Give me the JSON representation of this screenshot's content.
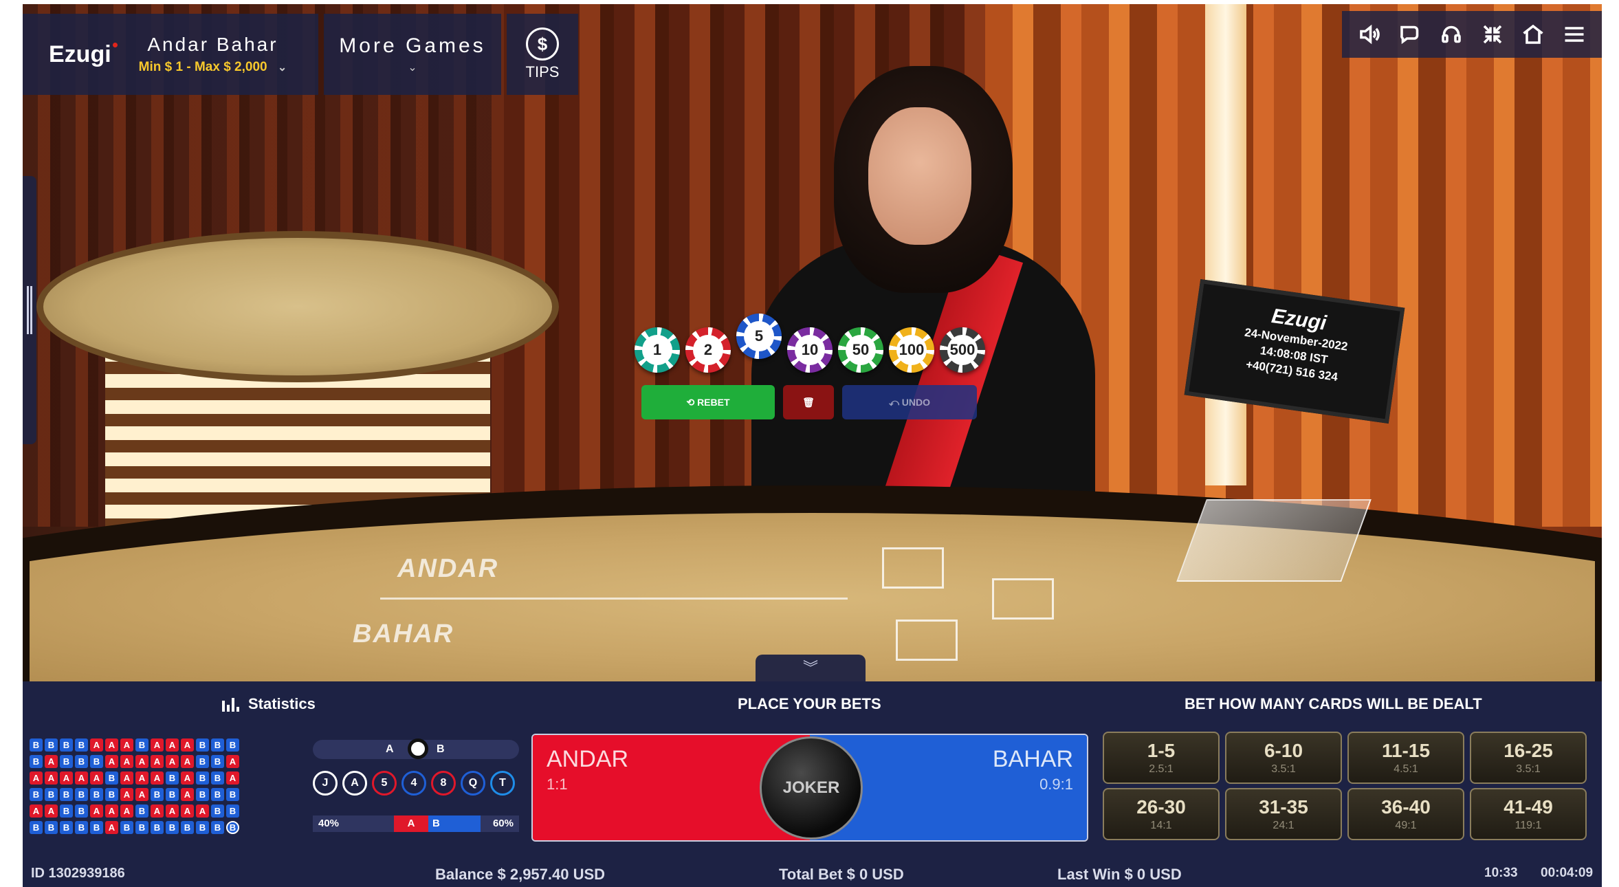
{
  "header": {
    "brand": "Ezugi",
    "game_name": "Andar Bahar",
    "limits": "Min $ 1 - Max $ 2,000",
    "more_games": "More Games",
    "tips_symbol": "$",
    "tips_label": "TIPS"
  },
  "toolbar": {
    "icons": [
      "speaker-icon",
      "chat-icon",
      "headset-icon",
      "minimize-icon",
      "home-icon",
      "menu-icon"
    ]
  },
  "video": {
    "felt_andar": "ANDAR",
    "felt_bahar": "BAHAR",
    "monitor_logo": "Ezugi",
    "monitor_date": "24-November-2022",
    "monitor_time": "14:08:08 IST",
    "monitor_phone": "+40(721) 516 324"
  },
  "chips": [
    {
      "value": "1",
      "color": "#12a08a"
    },
    {
      "value": "2",
      "color": "#d4212b"
    },
    {
      "value": "5",
      "color": "#1e56c8",
      "selected": true
    },
    {
      "value": "10",
      "color": "#7a2ca0"
    },
    {
      "value": "50",
      "color": "#2aa640"
    },
    {
      "value": "100",
      "color": "#f0b11a"
    },
    {
      "value": "500",
      "color": "#3a3a3a"
    }
  ],
  "actions": {
    "rebet": "⟲ REBET",
    "clear": "🗑",
    "undo": "⤺ UNDO"
  },
  "panel": {
    "statistics_title": "Statistics",
    "place_bets_title": "PLACE YOUR BETS",
    "cards_title": "BET HOW MANY CARDS WILL BE DEALT"
  },
  "statistics": {
    "bead_rows": [
      "BBBBAAABAAABBB",
      "BABBBAAAAAABBA",
      "AAAAABAAABABBA",
      "BBBBBBAABBABBB",
      "AABBAAABAAAABB",
      "BBBBBABBBBBBBB"
    ],
    "slider_a": "A",
    "slider_b": "B",
    "card_chips": [
      {
        "label": "J",
        "color": "#ffffff"
      },
      {
        "label": "A",
        "color": "#ffffff"
      },
      {
        "label": "5",
        "color": "#e0182a"
      },
      {
        "label": "4",
        "color": "#1f5fd6"
      },
      {
        "label": "8",
        "color": "#e0182a"
      },
      {
        "label": "Q",
        "color": "#1f5fd6"
      },
      {
        "label": "T",
        "color": "#1f8de8"
      }
    ],
    "pct_andar": "40%",
    "pct_bahar": "60%",
    "bar_a": "A",
    "bar_b": "B"
  },
  "bets": {
    "andar": {
      "name": "ANDAR",
      "odds": "1:1"
    },
    "bahar": {
      "name": "BAHAR",
      "odds": "0.9:1"
    },
    "joker": "JOKER"
  },
  "side_bets": [
    {
      "range": "1-5",
      "payout": "2.5:1"
    },
    {
      "range": "6-10",
      "payout": "3.5:1"
    },
    {
      "range": "11-15",
      "payout": "4.5:1"
    },
    {
      "range": "16-25",
      "payout": "3.5:1"
    },
    {
      "range": "26-30",
      "payout": "14:1"
    },
    {
      "range": "31-35",
      "payout": "24:1"
    },
    {
      "range": "36-40",
      "payout": "49:1"
    },
    {
      "range": "41-49",
      "payout": "119:1"
    }
  ],
  "status": {
    "round_id": "ID 1302939186",
    "balance": "Balance  $ 2,957.40 USD",
    "total_bet": "Total Bet $ 0 USD",
    "last_win": "Last Win $ 0 USD",
    "clock": "10:33",
    "timer": "00:04:09"
  }
}
